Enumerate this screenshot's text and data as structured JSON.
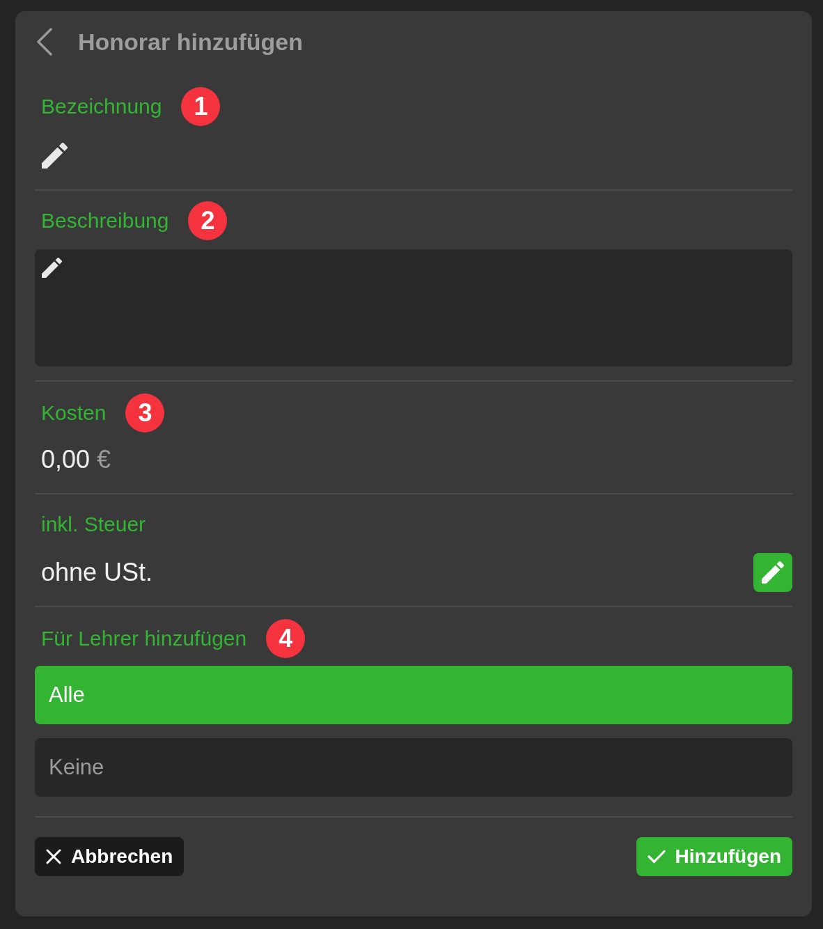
{
  "header": {
    "title": "Honorar hinzufügen"
  },
  "fields": [
    {
      "kind": "text",
      "label": "Bezeichnung",
      "badge": "1"
    },
    {
      "kind": "textarea",
      "label": "Beschreibung",
      "badge": "2"
    },
    {
      "kind": "amount",
      "label": "Kosten",
      "badge": "3",
      "value": "0,00",
      "unit": "€"
    },
    {
      "kind": "select",
      "label": "inkl. Steuer",
      "value": "ohne USt."
    },
    {
      "kind": "options",
      "label": "Für Lehrer hinzufügen",
      "badge": "4",
      "options": [
        {
          "label": "Alle",
          "selected": true
        },
        {
          "label": "Keine",
          "selected": false
        }
      ]
    }
  ],
  "actions": [
    {
      "kind": "cancel",
      "label": "Abbrechen"
    },
    {
      "kind": "confirm",
      "label": "Hinzufügen"
    }
  ]
}
